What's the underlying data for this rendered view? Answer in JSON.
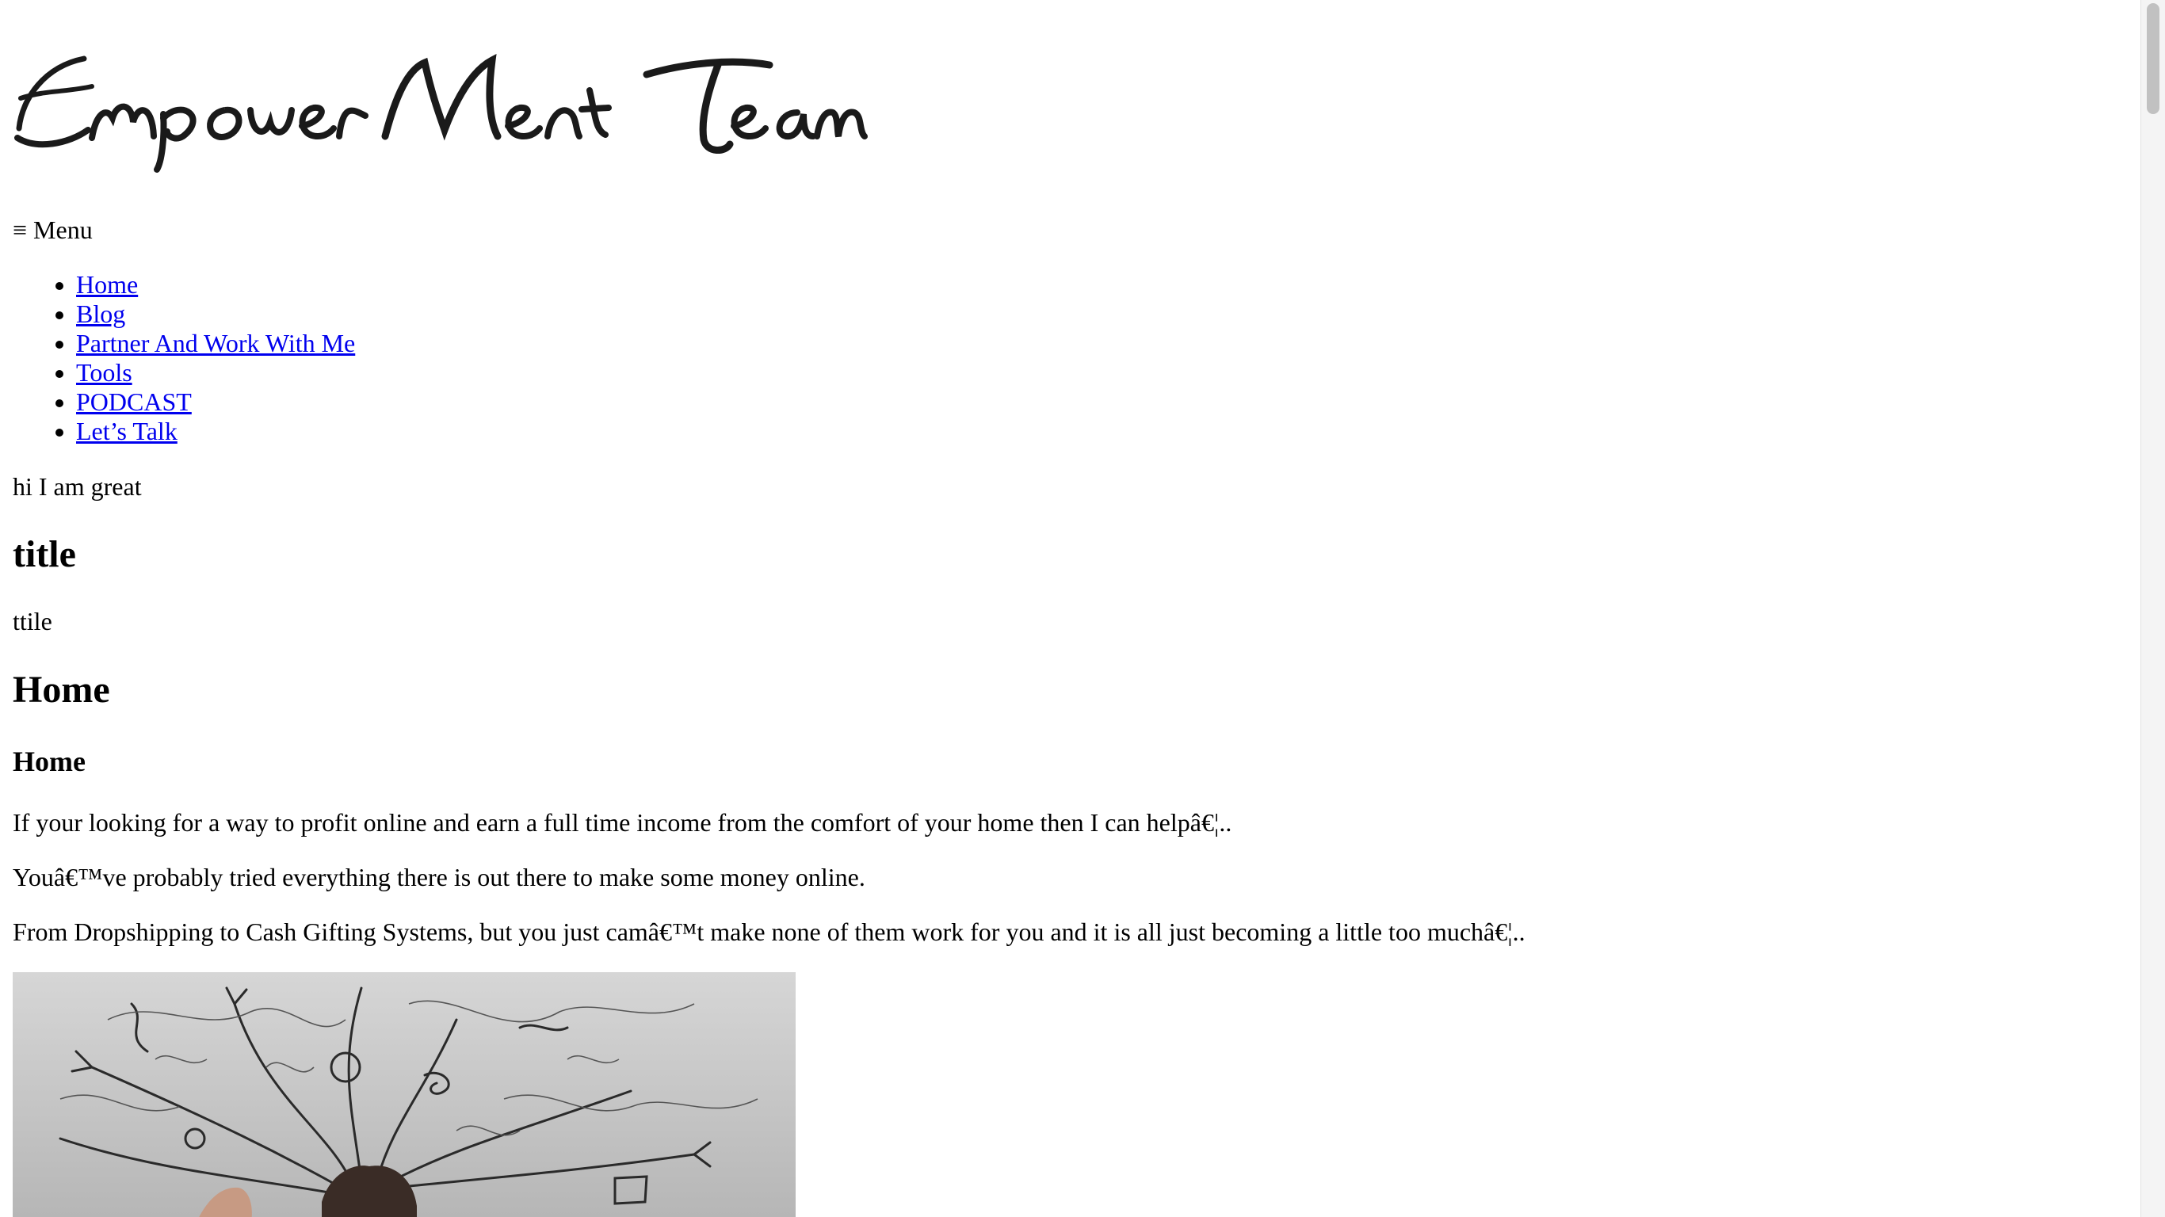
{
  "site": {
    "logo_text": "EmpowerMent Team"
  },
  "menu": {
    "toggle_icon": "≡",
    "toggle_label": "Menu"
  },
  "nav": {
    "items": [
      {
        "label": "Home"
      },
      {
        "label": "Blog"
      },
      {
        "label": "Partner And Work With Me"
      },
      {
        "label": "Tools"
      },
      {
        "label": "PODCAST"
      },
      {
        "label": "Let’s Talk"
      }
    ]
  },
  "main": {
    "intro": "hi I am great",
    "title_heading": "title",
    "title_sub": "ttile",
    "page_heading": "Home",
    "section_heading": "Home",
    "paragraphs": [
      "If your looking for a way to profit online and earn a full time income from the comfort of your home then I can helpâ€¦..",
      "Youâ€™ve probably tried everything there is out there to make some money online.",
      "From Dropshipping to Cash Gifting Systems, but you just camâ€™t make none of them work for you and it is all just becoming a little too muchâ€¦.."
    ]
  },
  "image": {
    "icon": "stressed-man-with-scribbles-image"
  },
  "colors": {
    "link": "#0000ee",
    "text": "#000000",
    "background": "#ffffff"
  }
}
